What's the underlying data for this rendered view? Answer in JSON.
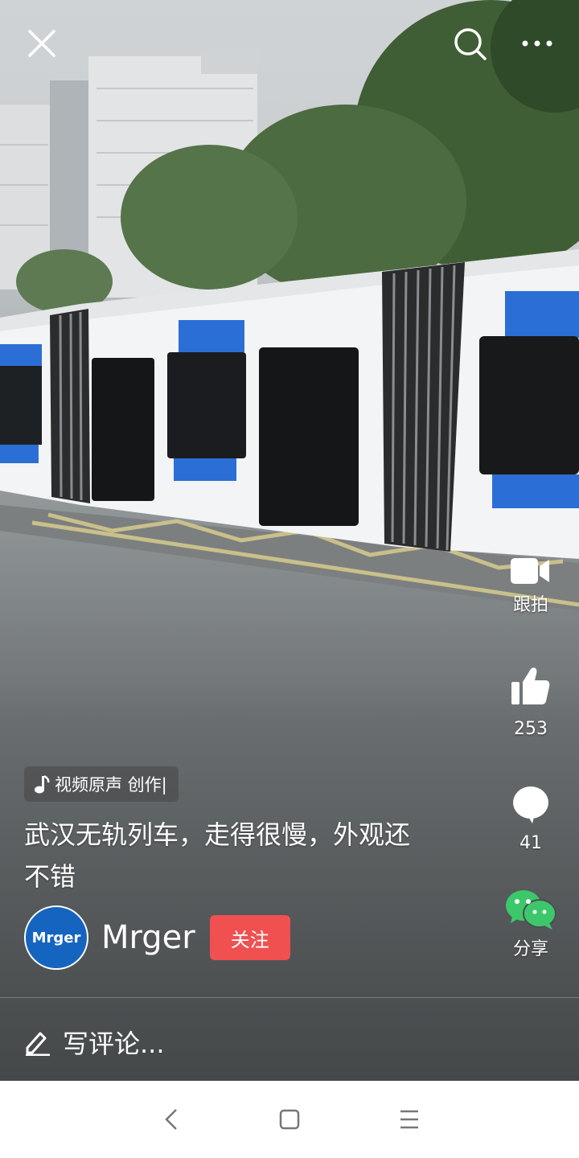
{
  "topbar": {
    "close_icon": "close-icon",
    "search_icon": "search-icon",
    "more_icon": "more-icon"
  },
  "actions": {
    "duet_label": "跟拍",
    "like_count": "253",
    "comment_count": "41",
    "share_label": "分享"
  },
  "music": {
    "label": "视频原声 创作|"
  },
  "caption": {
    "line1": "武汉无轨列车，走得很慢，外观还",
    "line2": "不错"
  },
  "author": {
    "avatar_text": "Mrger",
    "name": "Mrger",
    "follow_label": "关注"
  },
  "comment_input": {
    "placeholder": "写评论..."
  },
  "colors": {
    "follow": "#f05050",
    "avatar": "#1565c0",
    "wechat": "#3cc86a"
  }
}
